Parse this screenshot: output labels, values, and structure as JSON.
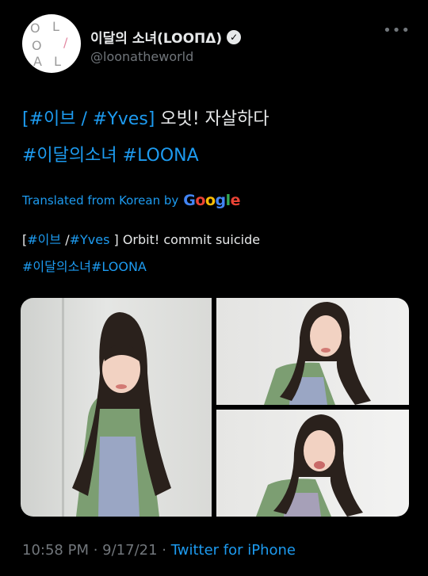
{
  "account": {
    "display_name": "이달의 소녀(LOOΠΔ)",
    "handle": "@loonatheworld",
    "avatar_letters": [
      "O",
      "L",
      "/",
      "O",
      "A",
      "L"
    ]
  },
  "tweet": {
    "line1_tag1": "[#이브",
    "line1_sep": " / ",
    "line1_tag2": "#Yves]",
    "line1_rest": " 오빗! 자살하다",
    "line2_tag1": "#이달의소녀",
    "line2_tag2": " #LOONA"
  },
  "translation": {
    "label": "Translated from Korean by",
    "provider": "Google",
    "line1_open": "[",
    "line1_tag1": "#이브",
    "line1_sep": " /",
    "line1_tag2": "#Yves",
    "line1_rest": " ] Orbit! commit suicide",
    "line2": "#이달의소녀#LOONA"
  },
  "footer": {
    "time": "10:58 PM",
    "sep1": " · ",
    "date": "9/17/21",
    "sep2": " · ",
    "source": "Twitter for iPhone"
  },
  "icons": {
    "verified": "verified-badge-icon",
    "more": "more-options-icon"
  },
  "colors": {
    "background": "#000000",
    "text": "#e7e9ea",
    "link": "#1d9bf0",
    "muted": "#71767b"
  }
}
